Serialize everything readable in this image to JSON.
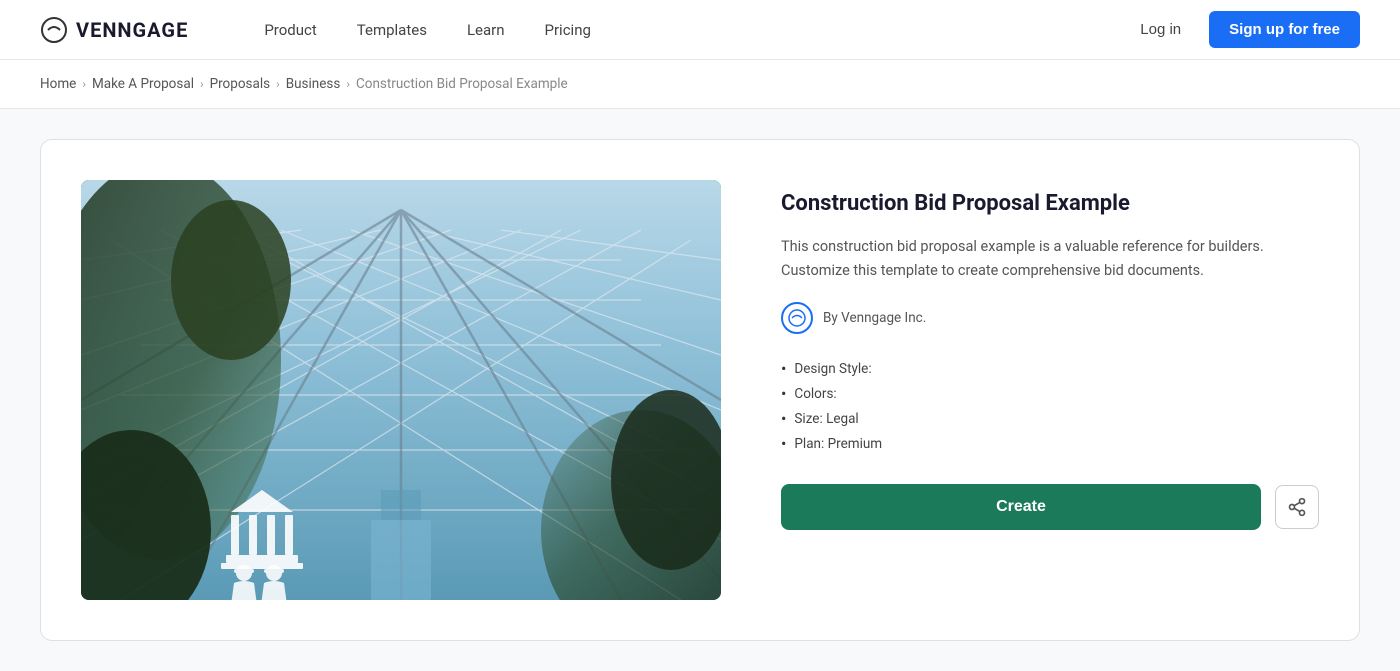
{
  "brand": {
    "name": "VENNGAGE",
    "logo_alt": "Venngage logo"
  },
  "nav": {
    "links": [
      {
        "label": "Product",
        "id": "product"
      },
      {
        "label": "Templates",
        "id": "templates"
      },
      {
        "label": "Learn",
        "id": "learn"
      },
      {
        "label": "Pricing",
        "id": "pricing"
      }
    ],
    "login_label": "Log in",
    "signup_label": "Sign up for free"
  },
  "breadcrumb": {
    "items": [
      {
        "label": "Home"
      },
      {
        "label": "Make A Proposal"
      },
      {
        "label": "Proposals"
      },
      {
        "label": "Business"
      },
      {
        "label": "Construction Bid Proposal Example",
        "current": true
      }
    ]
  },
  "template": {
    "title": "Construction Bid Proposal Example",
    "description": "This construction bid proposal example is a valuable reference for builders. Customize this template to create comprehensive bid documents.",
    "author": "By Venngage Inc.",
    "meta": [
      {
        "label": "Design Style:"
      },
      {
        "label": "Colors:"
      },
      {
        "label": "Size: Legal"
      },
      {
        "label": "Plan: Premium"
      }
    ],
    "create_label": "Create",
    "share_label": "Share"
  }
}
